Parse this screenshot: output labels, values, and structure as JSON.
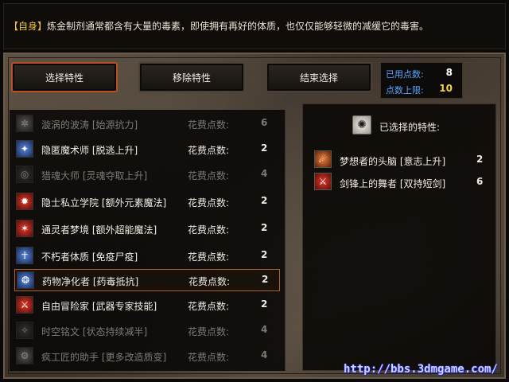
{
  "info": {
    "tag": "【自身】",
    "text": "炼金制剂通常都含有大量的毒素，即使拥有再好的体质，也仅仅能够轻微的减缓它的毒害。"
  },
  "tabs": {
    "select": "选择特性",
    "remove": "移除特性",
    "finish": "结束选择"
  },
  "points": {
    "used_label": "已用点数:",
    "used_value": "8",
    "max_label": "点数上限:",
    "max_value": "10"
  },
  "traits": [
    {
      "name": "漩涡的波涛 [始源抗力]",
      "cost_label": "花费点数:",
      "cost": "6",
      "icon": "vortex-icon"
    },
    {
      "name": "隐匿魔术师 [脱逃上升]",
      "cost_label": "花费点数:",
      "cost": "2",
      "icon": "magician-icon"
    },
    {
      "name": "猎魂大师 [灵魂夺取上升]",
      "cost_label": "花费点数:",
      "cost": "4",
      "icon": "soul-icon"
    },
    {
      "name": "隐士私立学院 [额外元素魔法]",
      "cost_label": "花费点数:",
      "cost": "2",
      "icon": "element-icon"
    },
    {
      "name": "通灵者梦境 [额外超能魔法]",
      "cost_label": "花费点数:",
      "cost": "2",
      "icon": "psionic-icon"
    },
    {
      "name": "不朽者体质 [免疫尸疫]",
      "cost_label": "花费点数:",
      "cost": "2",
      "icon": "body-icon"
    },
    {
      "name": "药物净化者 [药毒抵抗]",
      "cost_label": "花费点数:",
      "cost": "2",
      "icon": "potion-icon"
    },
    {
      "name": "自由冒险家 [武器专家技能]",
      "cost_label": "花费点数:",
      "cost": "2",
      "icon": "weapon-icon"
    },
    {
      "name": "时空铭文 [状态持续减半]",
      "cost_label": "花费点数:",
      "cost": "4",
      "icon": "rune-icon"
    },
    {
      "name": "疯工匠的助手 [更多改造质变]",
      "cost_label": "花费点数:",
      "cost": "4",
      "icon": "craft-icon"
    }
  ],
  "selected": {
    "header": "已选择的特性:",
    "items": [
      {
        "name": "梦想者的头脑 [意志上升]",
        "cost": "2",
        "icon": "mind-icon"
      },
      {
        "name": "剑锋上的舞者 [双持短剑]",
        "cost": "6",
        "icon": "blade-icon"
      }
    ]
  },
  "watermark": "http://bbs.3dmgame.com/"
}
